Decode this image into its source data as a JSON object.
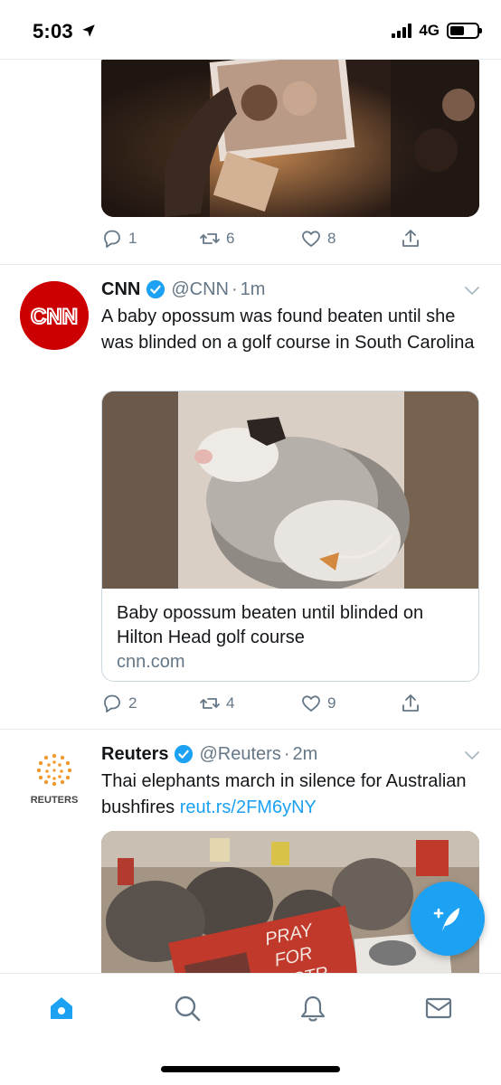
{
  "status_bar": {
    "time": "5:03",
    "network": "4G",
    "location_icon": "location-arrow-icon",
    "battery_level": 0.55
  },
  "feed": {
    "tweets": [
      {
        "image_desc_icon": "photo",
        "actions": {
          "replies": "1",
          "retweets": "6",
          "likes": "8"
        }
      },
      {
        "author": {
          "name": "CNN",
          "handle": "@CNN",
          "verified": true,
          "avatar_text": "CNN"
        },
        "time": "1m",
        "separator": "·",
        "text": "A baby opossum was found beaten until she was blinded on a golf course in South Carolina",
        "card": {
          "title": "Baby opossum beaten until blinded on Hilton Head golf course",
          "domain": "cnn.com"
        },
        "actions": {
          "replies": "2",
          "retweets": "4",
          "likes": "9"
        }
      },
      {
        "author": {
          "name": "Reuters",
          "handle": "@Reuters",
          "verified": true,
          "avatar_text": "REUTERS"
        },
        "time": "2m",
        "separator": "·",
        "text": "Thai elephants march in silence for Australian bushfires ",
        "link": "reut.rs/2FM6yNY",
        "image_sign_text": "PRAY FOR AUSTR"
      }
    ]
  },
  "tabs": [
    {
      "name": "home-icon",
      "active": true
    },
    {
      "name": "search-icon",
      "active": false
    },
    {
      "name": "notifications-icon",
      "active": false
    },
    {
      "name": "messages-icon",
      "active": false
    }
  ],
  "colors": {
    "accent": "#1da1f2",
    "muted": "#657786",
    "cnn_red": "#cc0000",
    "reuters_orange": "#f29a2e"
  }
}
